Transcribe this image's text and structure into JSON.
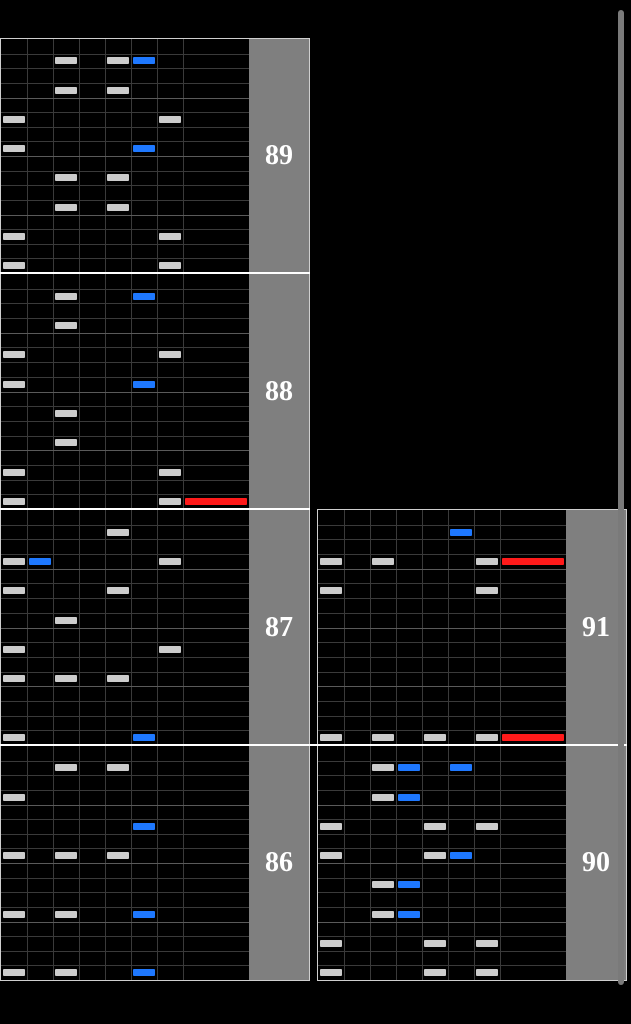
{
  "colors": {
    "white_note": "#cccccc",
    "blue_note": "#1e78ff",
    "red_note": "#ff1a1a",
    "panel": "#7f7f7f"
  },
  "measures": [
    {
      "number": "89",
      "notes": [
        {
          "lane": 2,
          "row": 1,
          "color": "white"
        },
        {
          "lane": 4,
          "row": 1,
          "color": "white"
        },
        {
          "lane": 5,
          "row": 1,
          "color": "blue"
        },
        {
          "lane": 2,
          "row": 3,
          "color": "white"
        },
        {
          "lane": 4,
          "row": 3,
          "color": "white"
        },
        {
          "lane": 0,
          "row": 5,
          "color": "white"
        },
        {
          "lane": 6,
          "row": 5,
          "color": "white"
        },
        {
          "lane": 0,
          "row": 7,
          "color": "white"
        },
        {
          "lane": 5,
          "row": 7,
          "color": "blue"
        },
        {
          "lane": 2,
          "row": 9,
          "color": "white"
        },
        {
          "lane": 4,
          "row": 9,
          "color": "white"
        },
        {
          "lane": 2,
          "row": 11,
          "color": "white"
        },
        {
          "lane": 4,
          "row": 11,
          "color": "white"
        },
        {
          "lane": 0,
          "row": 13,
          "color": "white"
        },
        {
          "lane": 6,
          "row": 13,
          "color": "white"
        },
        {
          "lane": 0,
          "row": 15,
          "color": "white"
        },
        {
          "lane": 6,
          "row": 15,
          "color": "white"
        }
      ]
    },
    {
      "number": "88",
      "notes": [
        {
          "lane": 2,
          "row": 1,
          "color": "white"
        },
        {
          "lane": 5,
          "row": 1,
          "color": "blue"
        },
        {
          "lane": 2,
          "row": 3,
          "color": "white"
        },
        {
          "lane": 0,
          "row": 5,
          "color": "white"
        },
        {
          "lane": 6,
          "row": 5,
          "color": "white"
        },
        {
          "lane": 0,
          "row": 7,
          "color": "white"
        },
        {
          "lane": 5,
          "row": 7,
          "color": "blue"
        },
        {
          "lane": 2,
          "row": 9,
          "color": "white"
        },
        {
          "lane": 2,
          "row": 11,
          "color": "white"
        },
        {
          "lane": 0,
          "row": 13,
          "color": "white"
        },
        {
          "lane": 6,
          "row": 13,
          "color": "white"
        },
        {
          "lane": 0,
          "row": 15,
          "color": "white"
        },
        {
          "lane": 6,
          "row": 15,
          "color": "white"
        },
        {
          "lane": 7,
          "row": 15,
          "color": "red"
        }
      ]
    },
    {
      "number": "87",
      "notes": [
        {
          "lane": 4,
          "row": 1,
          "color": "white"
        },
        {
          "lane": 0,
          "row": 3,
          "color": "white"
        },
        {
          "lane": 1,
          "row": 3,
          "color": "blue"
        },
        {
          "lane": 6,
          "row": 3,
          "color": "white"
        },
        {
          "lane": 0,
          "row": 5,
          "color": "white"
        },
        {
          "lane": 4,
          "row": 5,
          "color": "white"
        },
        {
          "lane": 2,
          "row": 7,
          "color": "white"
        },
        {
          "lane": 0,
          "row": 9,
          "color": "white"
        },
        {
          "lane": 6,
          "row": 9,
          "color": "white"
        },
        {
          "lane": 0,
          "row": 11,
          "color": "white"
        },
        {
          "lane": 2,
          "row": 11,
          "color": "white"
        },
        {
          "lane": 4,
          "row": 11,
          "color": "white"
        },
        {
          "lane": 0,
          "row": 15,
          "color": "white"
        },
        {
          "lane": 5,
          "row": 15,
          "color": "blue"
        }
      ]
    },
    {
      "number": "86",
      "notes": [
        {
          "lane": 2,
          "row": 1,
          "color": "white"
        },
        {
          "lane": 4,
          "row": 1,
          "color": "white"
        },
        {
          "lane": 0,
          "row": 3,
          "color": "white"
        },
        {
          "lane": 5,
          "row": 5,
          "color": "blue"
        },
        {
          "lane": 0,
          "row": 7,
          "color": "white"
        },
        {
          "lane": 2,
          "row": 7,
          "color": "white"
        },
        {
          "lane": 4,
          "row": 7,
          "color": "white"
        },
        {
          "lane": 0,
          "row": 11,
          "color": "white"
        },
        {
          "lane": 2,
          "row": 11,
          "color": "white"
        },
        {
          "lane": 5,
          "row": 11,
          "color": "blue"
        },
        {
          "lane": 0,
          "row": 15,
          "color": "white"
        },
        {
          "lane": 2,
          "row": 15,
          "color": "white"
        },
        {
          "lane": 5,
          "row": 15,
          "color": "blue"
        }
      ]
    },
    {
      "number": "91",
      "notes": [
        {
          "lane": 5,
          "row": 1,
          "color": "blue"
        },
        {
          "lane": 0,
          "row": 3,
          "color": "white"
        },
        {
          "lane": 2,
          "row": 3,
          "color": "white"
        },
        {
          "lane": 6,
          "row": 3,
          "color": "white"
        },
        {
          "lane": 7,
          "row": 3,
          "color": "red"
        },
        {
          "lane": 0,
          "row": 5,
          "color": "white"
        },
        {
          "lane": 6,
          "row": 5,
          "color": "white"
        },
        {
          "lane": 0,
          "row": 15,
          "color": "white"
        },
        {
          "lane": 2,
          "row": 15,
          "color": "white"
        },
        {
          "lane": 4,
          "row": 15,
          "color": "white"
        },
        {
          "lane": 6,
          "row": 15,
          "color": "white"
        },
        {
          "lane": 7,
          "row": 15,
          "color": "red"
        }
      ]
    },
    {
      "number": "90",
      "notes": [
        {
          "lane": 2,
          "row": 1,
          "color": "white"
        },
        {
          "lane": 3,
          "row": 1,
          "color": "blue"
        },
        {
          "lane": 5,
          "row": 1,
          "color": "blue"
        },
        {
          "lane": 2,
          "row": 3,
          "color": "white"
        },
        {
          "lane": 3,
          "row": 3,
          "color": "blue"
        },
        {
          "lane": 0,
          "row": 5,
          "color": "white"
        },
        {
          "lane": 4,
          "row": 5,
          "color": "white"
        },
        {
          "lane": 6,
          "row": 5,
          "color": "white"
        },
        {
          "lane": 0,
          "row": 7,
          "color": "white"
        },
        {
          "lane": 4,
          "row": 7,
          "color": "white"
        },
        {
          "lane": 5,
          "row": 7,
          "color": "blue"
        },
        {
          "lane": 2,
          "row": 9,
          "color": "white"
        },
        {
          "lane": 3,
          "row": 9,
          "color": "blue"
        },
        {
          "lane": 2,
          "row": 11,
          "color": "white"
        },
        {
          "lane": 3,
          "row": 11,
          "color": "blue"
        },
        {
          "lane": 0,
          "row": 13,
          "color": "white"
        },
        {
          "lane": 4,
          "row": 13,
          "color": "white"
        },
        {
          "lane": 6,
          "row": 13,
          "color": "white"
        },
        {
          "lane": 0,
          "row": 15,
          "color": "white"
        },
        {
          "lane": 4,
          "row": 15,
          "color": "white"
        },
        {
          "lane": 6,
          "row": 15,
          "color": "white"
        }
      ]
    }
  ]
}
